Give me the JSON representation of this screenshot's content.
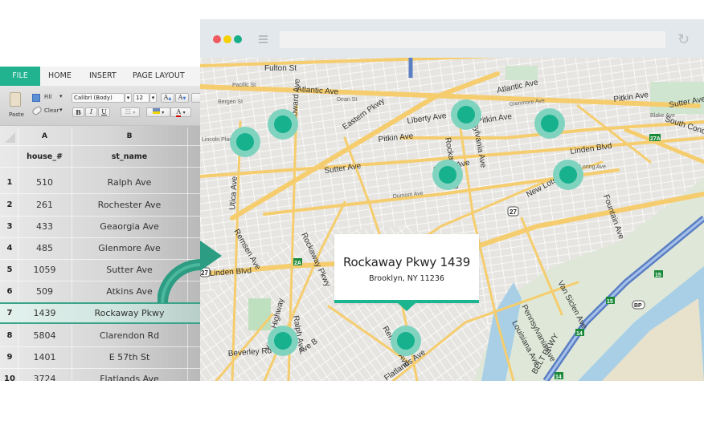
{
  "browser": {
    "window_controls": [
      "close",
      "minimize",
      "maximize"
    ],
    "menu_icon": "hamburger-icon",
    "url": "",
    "reload_icon": "reload-icon"
  },
  "spreadsheet": {
    "tabs": [
      "FILE",
      "HOME",
      "INSERT",
      "PAGE LAYOUT"
    ],
    "active_tab": "FILE",
    "ribbon": {
      "paste_label": "Paste",
      "fill_label": "Fill",
      "clear_label": "Clear",
      "font_name": "Calibri (Body)",
      "font_size": "12",
      "bold": "B",
      "italic": "I",
      "underline": "U",
      "grow_font": "A",
      "shrink_font": "A",
      "font_color": "A"
    },
    "columns": [
      "A",
      "B"
    ],
    "field_headers": [
      "house_#",
      "st_name"
    ],
    "rows": [
      {
        "num": "1",
        "house": "510",
        "street": "Ralph Ave"
      },
      {
        "num": "2",
        "house": "261",
        "street": "Rochester Ave"
      },
      {
        "num": "3",
        "house": "433",
        "street": "Geaorgia Ave"
      },
      {
        "num": "4",
        "house": "485",
        "street": "Glenmore Ave"
      },
      {
        "num": "5",
        "house": "1059",
        "street": "Sutter Ave"
      },
      {
        "num": "6",
        "house": "509",
        "street": "Atkins Ave"
      },
      {
        "num": "7",
        "house": "1439",
        "street": "Rockaway Pkwy"
      },
      {
        "num": "8",
        "house": "5804",
        "street": "Clarendon Rd"
      },
      {
        "num": "9",
        "house": "1401",
        "street": "E 57th St"
      },
      {
        "num": "10",
        "house": "3724",
        "street": "Flatlands Ave"
      }
    ],
    "selected_row": "7"
  },
  "map": {
    "popup": {
      "title": "Rockaway Pkwy 1439",
      "subtitle": "Brooklyn, NY 11236"
    },
    "road_labels": {
      "fulton": "Fulton St",
      "atlantic": "Atlantic Ave",
      "atlantic2": "Atlantic Ave",
      "eastern": "Eastern Pkwy",
      "liberty": "Liberty Ave",
      "pitkin": "Pitkin Ave",
      "pitkin2": "Pitkin Ave",
      "pitkin3": "Pitkin Ave",
      "sutter": "Sutter Ave",
      "sutter2": "Sutter Ave",
      "sutter3": "Sutter Ave",
      "south_conduit": "South Conduit",
      "linden": "Linden Blvd",
      "linden2": "Linden Blvd",
      "new_lots": "New Lots Ave",
      "fountain": "Fountain Ave",
      "utica": "Utica Ave",
      "remsen": "Remsen Ave",
      "remsen2": "Remsen Ave",
      "rockaway": "Rockaway Pkwy",
      "rockaway2": "Rockaway Ave",
      "howard": "Howard Ave",
      "kings_hwy": "Kings Highway",
      "beverley": "Beverley Rd",
      "ralph": "Ralph Ave",
      "ave_b": "Ave B",
      "flatlands": "Flatlands Ave",
      "pennsylvania": "Pennsylvania Ave",
      "pennsylvania2": "Pennsylvania Ave",
      "van_siclen": "Van Siclen Ave",
      "louisiana": "Louisiana Ave",
      "belt_pkwy": "BELT PKWY",
      "bergen": "Bergen St",
      "pacific": "Pacific St",
      "dean": "Dean St",
      "lincoln": "Lincoln Place",
      "blake": "Blake Ave",
      "loring": "Loring Ave",
      "glenmore": "Glenmore Ave",
      "dumont": "Dumont Ave"
    },
    "shields": {
      "route_27": "27",
      "route_27_left": "27",
      "exit_27a": "27A",
      "exit_2a": "2A",
      "exit_15a": "15",
      "exit_15b": "15",
      "exit_14a": "14",
      "exit_14b": "14",
      "bp": "BP"
    },
    "pin_count": 9
  },
  "colors": {
    "accent": "#21b28f",
    "pin_outer": "#7fd3bf",
    "pin_inner": "#17b18d",
    "connector": "#2c9c82"
  }
}
